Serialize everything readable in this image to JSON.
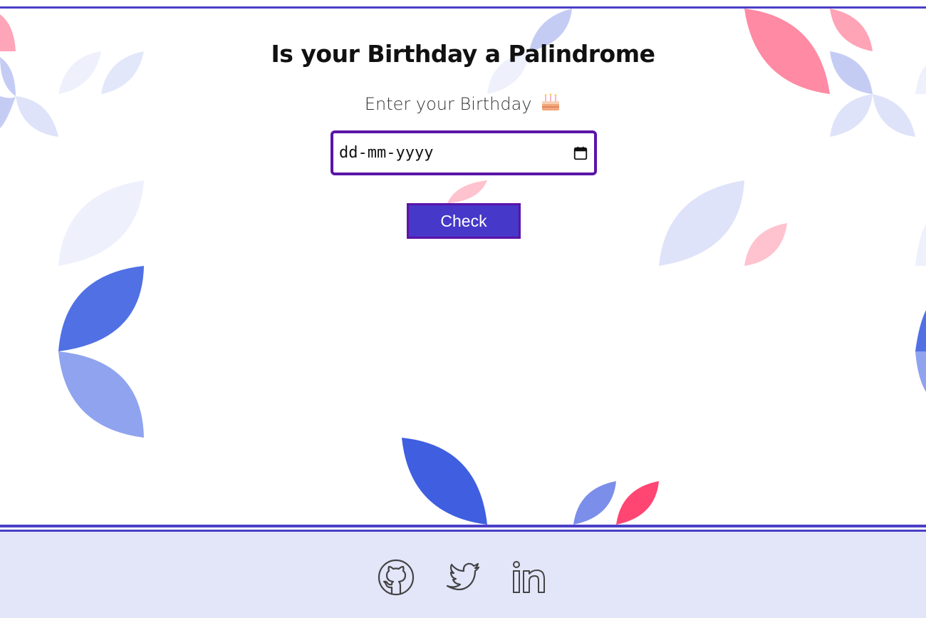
{
  "page": {
    "title": "Is your Birthday a Palindrome",
    "subtitle": "Enter your Birthday"
  },
  "form": {
    "date_placeholder": "dd-mm-yyyy",
    "check_label": "Check"
  },
  "footer": {
    "links": [
      {
        "name": "github",
        "icon": "github-icon"
      },
      {
        "name": "twitter",
        "icon": "twitter-icon"
      },
      {
        "name": "linkedin",
        "icon": "linkedin-icon"
      }
    ]
  },
  "colors": {
    "accent": "#4638c8",
    "border_purple": "#5b14a8",
    "footer_bg": "#e3e6f9",
    "petal_blue": "#3f5fe0",
    "petal_pink": "#ff4f78"
  }
}
